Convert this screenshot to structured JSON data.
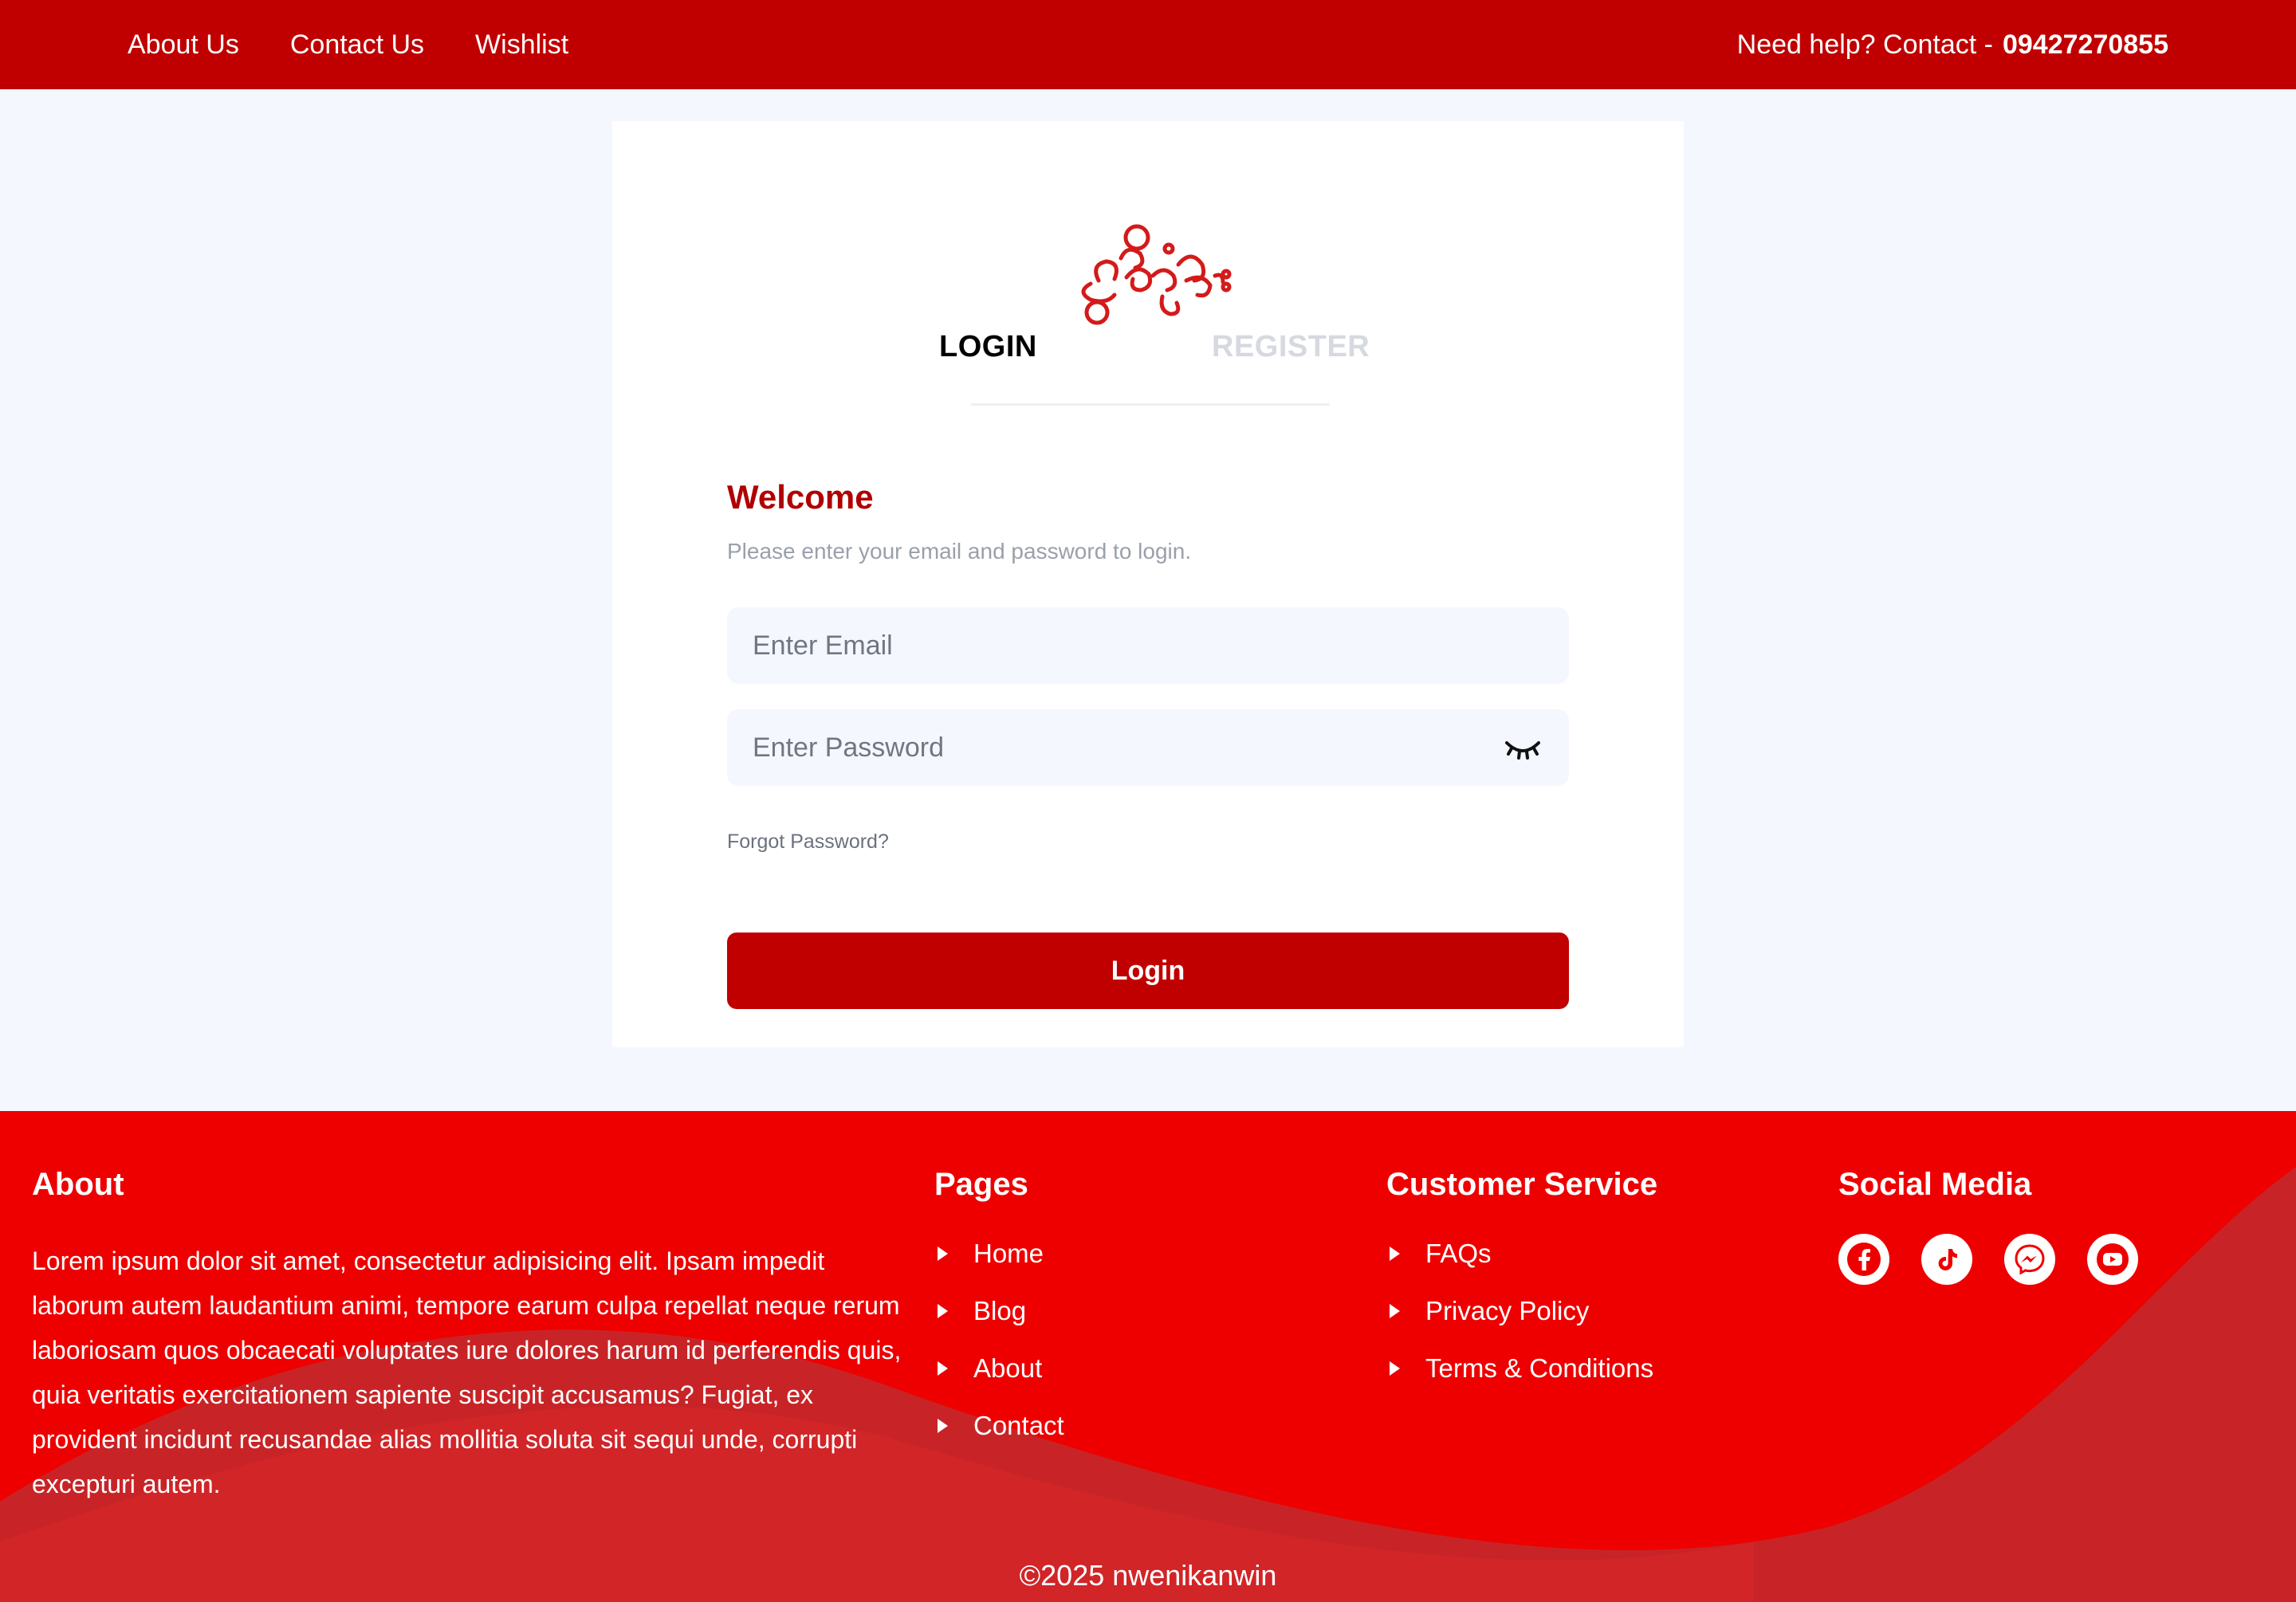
{
  "topbar": {
    "nav": [
      "About Us",
      "Contact Us",
      "Wishlist"
    ],
    "help_text": "Need help? Contact -",
    "phone": "09427270855"
  },
  "auth": {
    "tabs": {
      "login": "LOGIN",
      "register": "REGISTER"
    },
    "welcome": "Welcome",
    "subtitle": "Please enter your email and password to login.",
    "email_placeholder": "Enter Email",
    "password_placeholder": "Enter Password",
    "forgot": "Forgot Password?",
    "login_button": "Login"
  },
  "footer": {
    "about_title": "About",
    "about_text": "Lorem ipsum dolor sit amet, consectetur adipisicing elit. Ipsam impedit laborum autem laudantium animi, tempore earum culpa repellat neque rerum laboriosam quos obcaecati voluptates iure dolores harum id perferendis quis, quia veritatis exercitationem sapiente suscipit accusamus? Fugiat, ex provident incidunt recusandae alias mollitia soluta sit sequi unde, corrupti excepturi autem.",
    "pages_title": "Pages",
    "pages": [
      "Home",
      "Blog",
      "About",
      "Contact"
    ],
    "service_title": "Customer Service",
    "service": [
      "FAQs",
      "Privacy Policy",
      "Terms & Conditions"
    ],
    "social_title": "Social Media",
    "social_icons": [
      "facebook-icon",
      "tiktok-icon",
      "messenger-icon",
      "youtube-icon"
    ],
    "copyright": "©2025 nwenikanwin"
  },
  "colors": {
    "brand": "#c00000",
    "footer": "#ee0000",
    "wave": "#c82427"
  }
}
